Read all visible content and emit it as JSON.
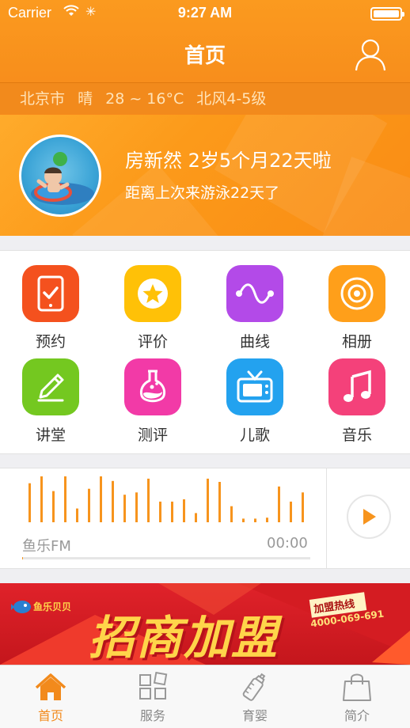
{
  "status_bar": {
    "carrier": "Carrier",
    "time": "9:27 AM"
  },
  "nav": {
    "title": "首页"
  },
  "weather": {
    "city": "北京市",
    "condition": "晴",
    "temperature": "28 ~ 16°C",
    "wind": "北风4-5级"
  },
  "profile": {
    "name_line": "房新然 2岁5个月22天啦",
    "sub_line": "距离上次来游泳22天了"
  },
  "grid": {
    "items": [
      {
        "label": "预约",
        "icon": "phone-check-icon",
        "color": "#f4511e"
      },
      {
        "label": "评价",
        "icon": "star-icon",
        "color": "#ffc107"
      },
      {
        "label": "曲线",
        "icon": "wave-icon",
        "color": "#b34ae8"
      },
      {
        "label": "相册",
        "icon": "camera-icon",
        "color": "#ff9f1a"
      },
      {
        "label": "讲堂",
        "icon": "pencil-icon",
        "color": "#74c820"
      },
      {
        "label": "测评",
        "icon": "flask-icon",
        "color": "#f23aa7"
      },
      {
        "label": "儿歌",
        "icon": "tv-icon",
        "color": "#23a2ef"
      },
      {
        "label": "音乐",
        "icon": "music-note-icon",
        "color": "#f4417a"
      }
    ]
  },
  "fm": {
    "label": "鱼乐FM",
    "time": "00:00",
    "progress": 0.003,
    "accent": "#f7941d",
    "bar_levels": [
      0.85,
      1.0,
      0.68,
      1.0,
      0.3,
      0.73,
      1.0,
      0.9,
      0.6,
      0.65,
      0.95,
      0.45,
      0.45,
      0.5,
      0.2,
      0.95,
      0.88,
      0.35,
      0.08,
      0.08,
      0.1,
      0.78,
      0.45,
      0.65
    ]
  },
  "ad": {
    "brand": "鱼乐贝贝",
    "headline": "招商加盟",
    "hotline_label": "加盟热线",
    "phone": "4000-069-691"
  },
  "tabs": [
    {
      "label": "首页",
      "icon": "home-icon",
      "active": true
    },
    {
      "label": "服务",
      "icon": "grid-icon",
      "active": false
    },
    {
      "label": "育婴",
      "icon": "baby-bottle-icon",
      "active": false
    },
    {
      "label": "简介",
      "icon": "shopping-bag-icon",
      "active": false
    }
  ],
  "colors": {
    "primary": "#f7931e",
    "tab_active": "#f28a1c",
    "tab_inactive": "#888888"
  }
}
